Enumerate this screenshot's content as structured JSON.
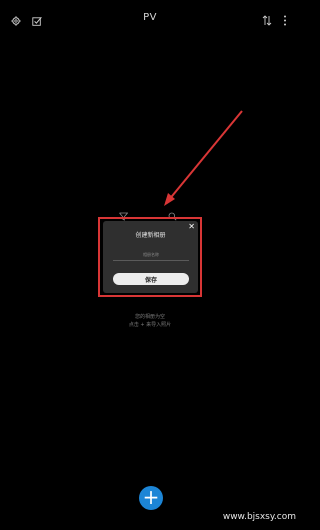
{
  "header": {
    "title": "PV",
    "left_icons": [
      "settings-icon",
      "select-icon"
    ],
    "right_icons": [
      "sort-icon",
      "more-icon"
    ]
  },
  "empty_state": {
    "line1": "您的相册为空",
    "line2": "点击 + 来导入照片"
  },
  "dialog": {
    "title": "创建新相册",
    "input_placeholder": "相册名称",
    "save_label": "保存",
    "close_icon": "close-icon"
  },
  "fab": {
    "icon": "plus-icon",
    "color": "#1c85d6"
  },
  "watermark": "www.bjsxsy.com",
  "colors": {
    "annotation": "#d93636",
    "background": "#000000",
    "dialog_bg": "#2f2f2f"
  }
}
